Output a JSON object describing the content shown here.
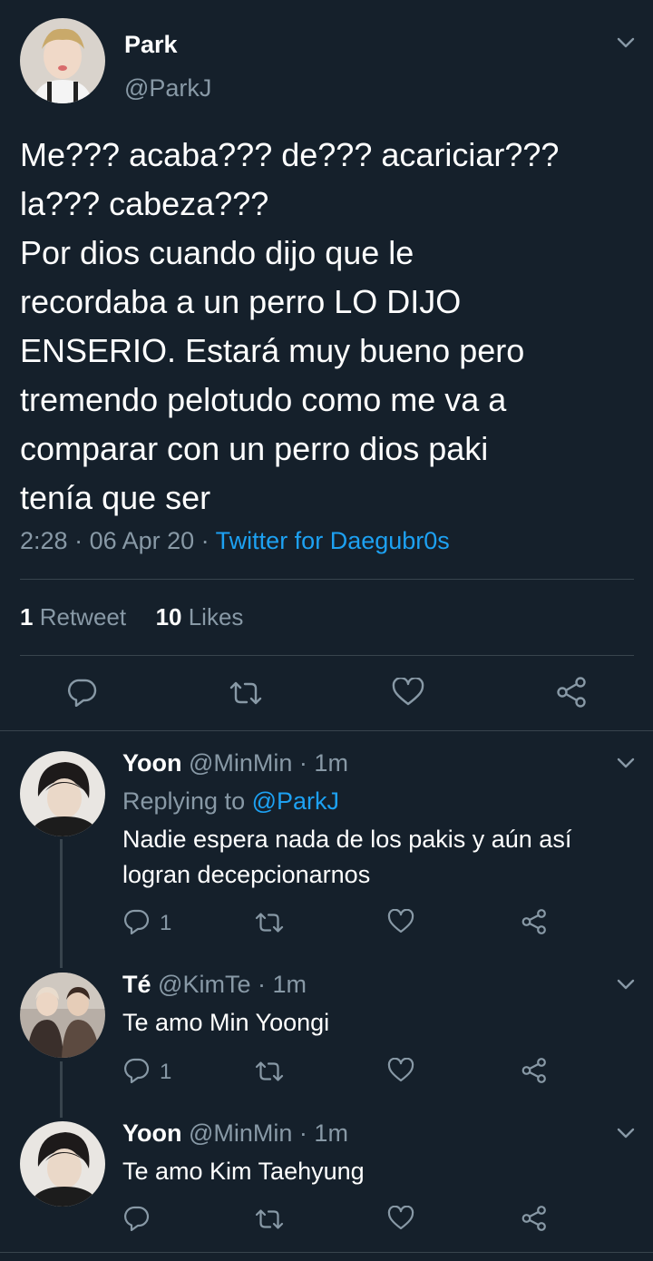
{
  "main_tweet": {
    "display_name": "Park",
    "handle": "@ParkJ",
    "text_lines": [
      "Me??? acaba??? de??? acariciar???",
      "la??? cabeza???",
      "Por dios cuando dijo que le",
      "recordaba a un perro LO DIJO",
      "ENSERIO. Estará muy bueno pero",
      "tremendo pelotudo como me va a",
      "comparar con un perro dios paki",
      "tenía que ser"
    ],
    "time": "2:28",
    "date": "06 Apr 20",
    "source": "Twitter for Daegubr0s",
    "retweet_count": "1",
    "retweet_label": "Retweet",
    "like_count": "10",
    "like_label": "Likes",
    "icons": [
      "reply-icon",
      "retweet-icon",
      "like-icon",
      "share-icon"
    ]
  },
  "replies": [
    {
      "display_name": "Yoon",
      "handle": "@MinMin",
      "time": "1m",
      "replying_prefix": "Replying to",
      "replying_to": "@ParkJ",
      "text_lines": [
        "Nadie espera nada de los pakis y aún así",
        "logran decepcionarnos"
      ],
      "reply_count": "1"
    },
    {
      "display_name": "Té",
      "handle": "@KimTe",
      "time": "1m",
      "text_lines": [
        "Te amo Min Yoongi"
      ],
      "reply_count": "1"
    },
    {
      "display_name": "Yoon",
      "handle": "@MinMin",
      "time": "1m",
      "text_lines": [
        "Te amo Kim Taehyung"
      ],
      "reply_count": ""
    }
  ],
  "colors": {
    "background": "#15202b",
    "text": "#ffffff",
    "muted": "#8899a6",
    "accent": "#1da1f2",
    "divider": "#38444d"
  }
}
